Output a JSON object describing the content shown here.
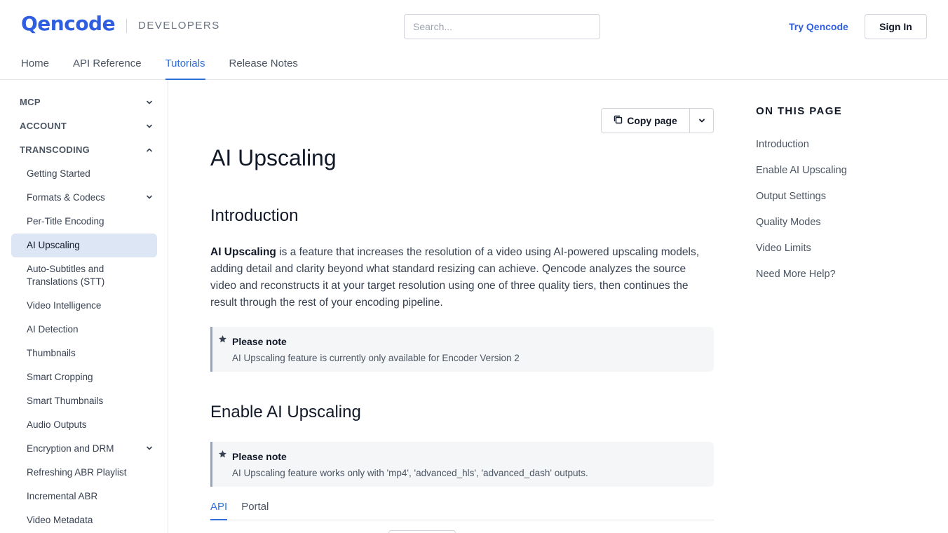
{
  "header": {
    "logo": "Qencode",
    "section_label": "DEVELOPERS",
    "search_placeholder": "Search...",
    "try_link": "Try Qencode",
    "signin": "Sign In"
  },
  "topnav": [
    {
      "label": "Home",
      "active": false
    },
    {
      "label": "API Reference",
      "active": false
    },
    {
      "label": "Tutorials",
      "active": true
    },
    {
      "label": "Release Notes",
      "active": false
    }
  ],
  "sidebar": {
    "sections": [
      {
        "label": "MCP",
        "chevron": "chevron-down-icon"
      },
      {
        "label": "ACCOUNT",
        "chevron": "chevron-down-icon"
      },
      {
        "label": "TRANSCODING",
        "chevron": "chevron-up-icon"
      }
    ],
    "items": [
      {
        "label": "Getting Started"
      },
      {
        "label": "Formats & Codecs",
        "chevron": "chevron-down-icon"
      },
      {
        "label": "Per-Title Encoding"
      },
      {
        "label": "AI Upscaling",
        "active": true
      },
      {
        "label": "Auto-Subtitles and Translations (STT)"
      },
      {
        "label": "Video Intelligence"
      },
      {
        "label": "AI Detection"
      },
      {
        "label": "Thumbnails"
      },
      {
        "label": "Smart Cropping"
      },
      {
        "label": "Smart Thumbnails"
      },
      {
        "label": "Audio Outputs"
      },
      {
        "label": "Encryption and DRM",
        "chevron": "chevron-down-icon"
      },
      {
        "label": "Refreshing ABR Playlist"
      },
      {
        "label": "Incremental ABR"
      },
      {
        "label": "Video Metadata"
      }
    ]
  },
  "main": {
    "copy_button": "Copy page",
    "title": "AI Upscaling",
    "intro_heading": "Introduction",
    "intro_bold": "AI Upscaling",
    "intro_text": " is a feature that increases the resolution of a video using AI-powered upscaling models, adding detail and clarity beyond what standard resizing can achieve. Qencode analyzes the source video and reconstructs it at your target resolution using one of three quality tiers, then continues the result through the rest of your encoding pipeline.",
    "note1": {
      "title": "Please note",
      "text": "AI Upscaling feature is currently only available for Encoder Version 2"
    },
    "enable_heading": "Enable AI Upscaling",
    "note2": {
      "title": "Please note",
      "text": "AI Upscaling feature works only with 'mp4', 'advanced_hls', 'advanced_dash' outputs."
    },
    "tabs": [
      {
        "label": "API",
        "active": true
      },
      {
        "label": "Portal",
        "active": false
      }
    ]
  },
  "toc": {
    "title": "ON THIS PAGE",
    "items": [
      "Introduction",
      "Enable AI Upscaling",
      "Output Settings",
      "Quality Modes",
      "Video Limits",
      "Need More Help?"
    ]
  },
  "colors": {
    "brand": "#2f5fe0",
    "active_tab": "#2f6fd8",
    "active_sidebar_bg": "#dde6f5",
    "note_bg": "#f5f6f8"
  }
}
